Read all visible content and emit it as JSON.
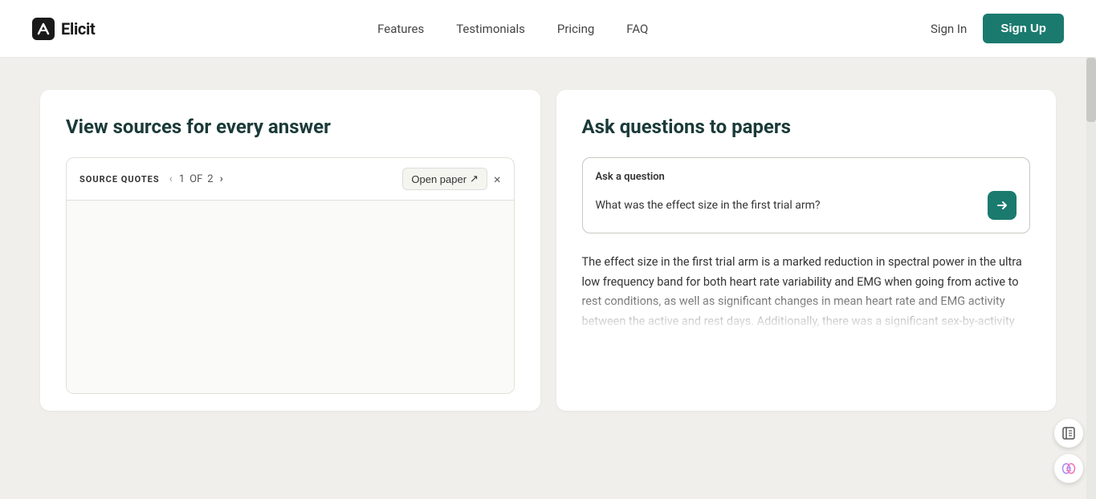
{
  "header": {
    "logo_text": "Elicit",
    "nav": {
      "items": [
        {
          "label": "Features",
          "id": "features"
        },
        {
          "label": "Testimonials",
          "id": "testimonials"
        },
        {
          "label": "Pricing",
          "id": "pricing"
        },
        {
          "label": "FAQ",
          "id": "faq"
        }
      ]
    },
    "sign_in_label": "Sign In",
    "sign_up_label": "Sign Up"
  },
  "left_panel": {
    "title": "View sources for every answer",
    "source_quotes": {
      "label": "SOURCE QUOTES",
      "current_page": "1",
      "of_label": "OF",
      "total_pages": "2",
      "open_paper_label": "Open paper",
      "open_paper_icon": "↗",
      "close_icon": "×",
      "prev_arrow": "‹",
      "next_arrow": "›"
    }
  },
  "right_panel": {
    "title": "Ask questions to papers",
    "ask_question": {
      "label": "Ask a question",
      "input_value": "What was the effect size in the first trial arm?",
      "submit_icon": "→"
    },
    "answer_text": "The effect size in the first trial arm is a marked reduction in spectral power in the ultra low frequency band for both heart rate variability and EMG when going from active to rest conditions, as well as significant changes in mean heart rate and EMG activity between the active and rest days. Additionally, there was a significant sex-by-activity"
  },
  "floating_icons": {
    "book_icon": "📖",
    "brain_icon": "🧠"
  }
}
